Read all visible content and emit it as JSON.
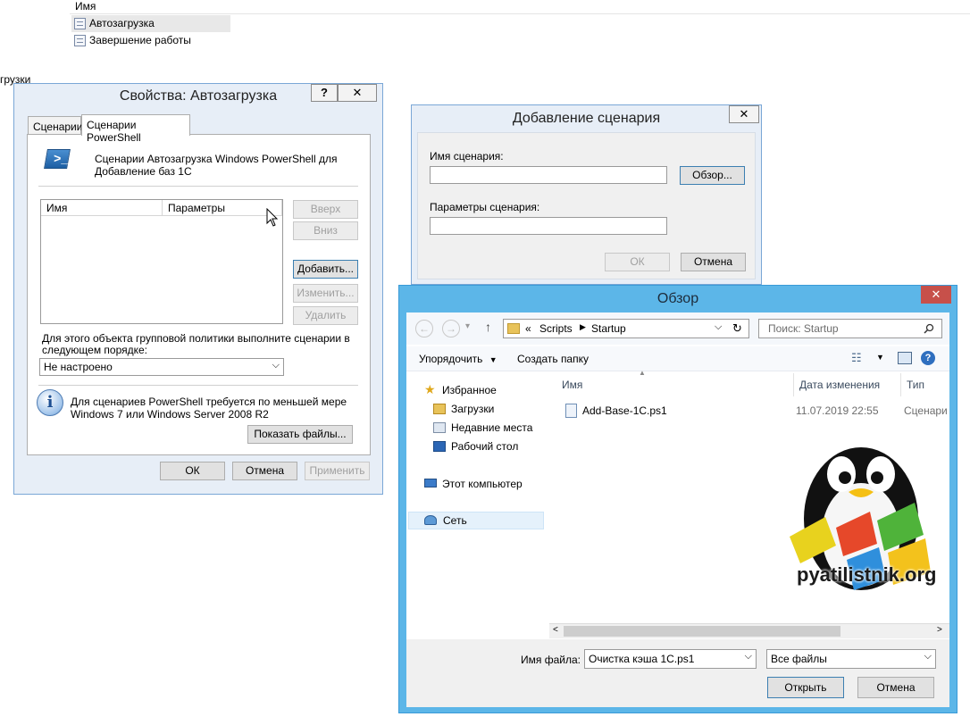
{
  "background": {
    "column_header": "Имя",
    "items": [
      "Автозагрузка",
      "Завершение работы"
    ],
    "stray_text": "грузки"
  },
  "properties_dialog": {
    "title": "Свойства: Автозагрузка",
    "help_button": "?",
    "close_button": "✕",
    "tabs": [
      "Сценарии",
      "Сценарии PowerShell"
    ],
    "description_line1": "Сценарии Автозагрузка Windows PowerShell для",
    "description_line2": "Добавление баз 1С",
    "columns": [
      "Имя",
      "Параметры"
    ],
    "buttons": {
      "up": "Вверх",
      "down": "Вниз",
      "add": "Добавить...",
      "edit": "Изменить...",
      "remove": "Удалить"
    },
    "order_label_line1": "Для этого объекта групповой политики выполните сценарии в",
    "order_label_line2": "следующем порядке:",
    "order_value": "Не настроено",
    "info_line1": "Для сценариев PowerShell требуется по меньшей мере",
    "info_line2": "Windows 7 или Windows Server 2008 R2",
    "show_files": "Показать файлы...",
    "ok": "ОК",
    "cancel": "Отмена",
    "apply": "Применить"
  },
  "add_script_dialog": {
    "title": "Добавление сценария",
    "close_button": "✕",
    "name_label": "Имя сценария:",
    "name_value": "",
    "browse": "Обзор...",
    "params_label": "Параметры сценария:",
    "params_value": "",
    "ok": "ОК",
    "cancel": "Отмена"
  },
  "browse_dialog": {
    "title": "Обзор",
    "close_button": "✕",
    "path_prefix": "«",
    "path": [
      "Scripts",
      "Startup"
    ],
    "search_placeholder": "Поиск: Startup",
    "organize": "Упорядочить",
    "new_folder": "Создать папку",
    "tree": {
      "favorites": "Избранное",
      "downloads": "Загрузки",
      "recent": "Недавние места",
      "desktop": "Рабочий стол",
      "computer": "Этот компьютер",
      "network": "Сеть"
    },
    "columns": [
      "Имя",
      "Дата изменения",
      "Тип"
    ],
    "files": [
      {
        "name": "Add-Base-1C.ps1",
        "date": "11.07.2019 22:55",
        "type": "Сценари"
      }
    ],
    "filename_label": "Имя файла:",
    "filename_value": "Очистка кэша 1С.ps1",
    "filetype_value": "Все файлы",
    "open": "Открыть",
    "cancel": "Отмена"
  },
  "watermark": "pyatilistnik.org"
}
